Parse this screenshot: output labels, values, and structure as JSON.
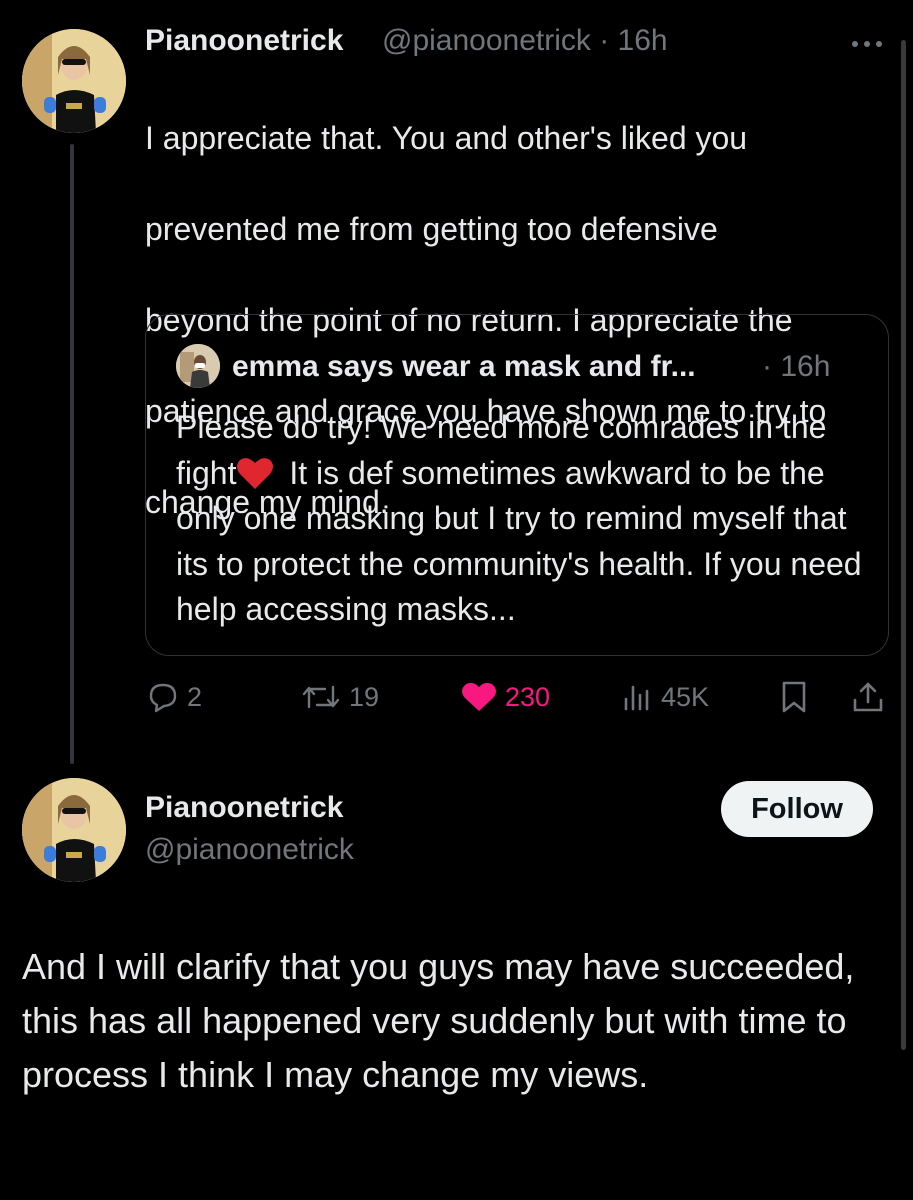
{
  "tweet1": {
    "display_name": "Pianoonetrick",
    "handle_time": "@pianoonetrick · 16h",
    "text_lines": [
      "I appreciate that. You and other's liked you",
      "prevented me from getting too defensive",
      "beyond the point of no return. I appreciate the",
      "patience and grace you have shown me to try to",
      "change my mind."
    ],
    "quoted": {
      "display_name": "emma says wear a mask and fr...",
      "time": "· 16h",
      "text_before_emoji": "Please do try! We need more comrades in the fight",
      "text_after_emoji": " It is def sometimes awkward to be the only one masking but I try to remind myself that its to protect the community's health. If you need help accessing masks..."
    },
    "actions": {
      "replies": "2",
      "reposts": "19",
      "likes": "230",
      "views": "45K"
    }
  },
  "tweet2": {
    "display_name": "Pianoonetrick",
    "handle": "@pianoonetrick",
    "follow_label": "Follow",
    "text": "And I will clarify that you guys may have succeeded, this has all happened very suddenly but with time to process I think I may change my views."
  },
  "icons": [
    "more-icon",
    "reply-icon",
    "repost-icon",
    "like-icon",
    "views-icon",
    "bookmark-icon",
    "share-icon",
    "heart-emoji-icon"
  ],
  "colors": {
    "background": "#000000",
    "text": "#e7e9ea",
    "secondary": "#71767b",
    "like": "#f91880",
    "follow_bg": "#eff3f4"
  }
}
